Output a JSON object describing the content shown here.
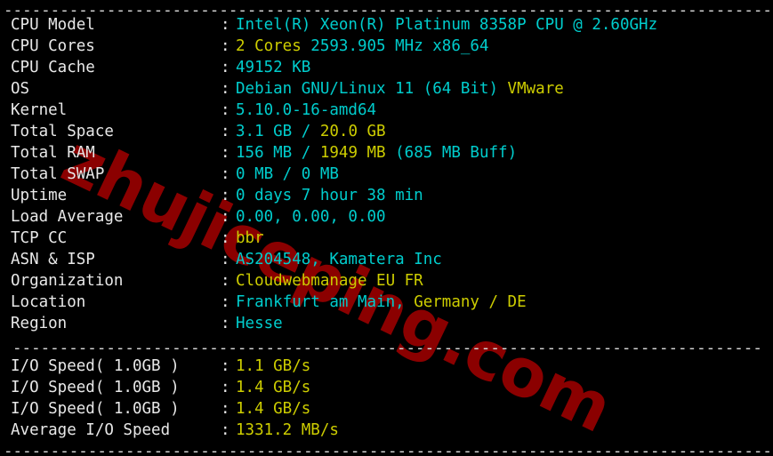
{
  "terminal": {
    "background": "#000000",
    "colors": {
      "label": "#e8e8e8",
      "cyan": "#00cdcd",
      "yellow": "#cdcd00",
      "separator": "#d8d8d8",
      "watermark": "#8b0000"
    },
    "watermark_text": "zhujiceping.com",
    "separator_top": "----------------------------------------------------------------------------------",
    "separator_middle": "--------------------------------------------------------------------------------",
    "separator_bottom": "----------------------------------------------------------------------------------",
    "colon": ":",
    "system_rows": [
      {
        "label": "CPU Model",
        "segments": [
          {
            "text": "Intel(R) Xeon(R) Platinum 8358P CPU @ 2.60GHz",
            "color": "cyan"
          }
        ]
      },
      {
        "label": "CPU Cores",
        "segments": [
          {
            "text": "2 Cores ",
            "color": "yellow"
          },
          {
            "text": "2593.905 MHz x86_64",
            "color": "cyan"
          }
        ]
      },
      {
        "label": "CPU Cache",
        "segments": [
          {
            "text": "49152 KB",
            "color": "cyan"
          }
        ]
      },
      {
        "label": "OS",
        "segments": [
          {
            "text": "Debian GNU/Linux 11 (64 Bit) ",
            "color": "cyan"
          },
          {
            "text": "VMware",
            "color": "yellow"
          }
        ]
      },
      {
        "label": "Kernel",
        "segments": [
          {
            "text": "5.10.0-16-amd64",
            "color": "cyan"
          }
        ]
      },
      {
        "label": "Total Space",
        "segments": [
          {
            "text": "3.1 GB ",
            "color": "cyan"
          },
          {
            "text": "/ ",
            "color": "cyan"
          },
          {
            "text": "20.0 GB",
            "color": "yellow"
          }
        ]
      },
      {
        "label": "Total RAM",
        "segments": [
          {
            "text": "156 MB ",
            "color": "cyan"
          },
          {
            "text": "/ ",
            "color": "cyan"
          },
          {
            "text": "1949 MB ",
            "color": "yellow"
          },
          {
            "text": "(685 MB Buff)",
            "color": "cyan"
          }
        ]
      },
      {
        "label": "Total SWAP",
        "segments": [
          {
            "text": "0 MB / 0 MB",
            "color": "cyan"
          }
        ]
      },
      {
        "label": "Uptime",
        "segments": [
          {
            "text": "0 days 7 hour 38 min",
            "color": "cyan"
          }
        ]
      },
      {
        "label": "Load Average",
        "segments": [
          {
            "text": "0.00, 0.00, 0.00",
            "color": "cyan"
          }
        ]
      },
      {
        "label": "TCP CC",
        "segments": [
          {
            "text": "bbr",
            "color": "yellow"
          }
        ]
      },
      {
        "label": "ASN & ISP",
        "segments": [
          {
            "text": "AS204548, Kamatera Inc",
            "color": "cyan"
          }
        ]
      },
      {
        "label": "Organization",
        "segments": [
          {
            "text": "Cloudwebmanage EU FR",
            "color": "yellow"
          }
        ]
      },
      {
        "label": "Location",
        "segments": [
          {
            "text": "Frankfurt am Main, ",
            "color": "cyan"
          },
          {
            "text": "Germany / DE",
            "color": "yellow"
          }
        ]
      },
      {
        "label": "Region",
        "segments": [
          {
            "text": "Hesse",
            "color": "cyan"
          }
        ]
      }
    ],
    "io_rows": [
      {
        "label": "I/O Speed( 1.0GB )",
        "segments": [
          {
            "text": "1.1 GB/s",
            "color": "yellow"
          }
        ]
      },
      {
        "label": "I/O Speed( 1.0GB )",
        "segments": [
          {
            "text": "1.4 GB/s",
            "color": "yellow"
          }
        ]
      },
      {
        "label": "I/O Speed( 1.0GB )",
        "segments": [
          {
            "text": "1.4 GB/s",
            "color": "yellow"
          }
        ]
      },
      {
        "label": "Average I/O Speed",
        "segments": [
          {
            "text": "1331.2 MB/s",
            "color": "yellow"
          }
        ]
      }
    ]
  }
}
